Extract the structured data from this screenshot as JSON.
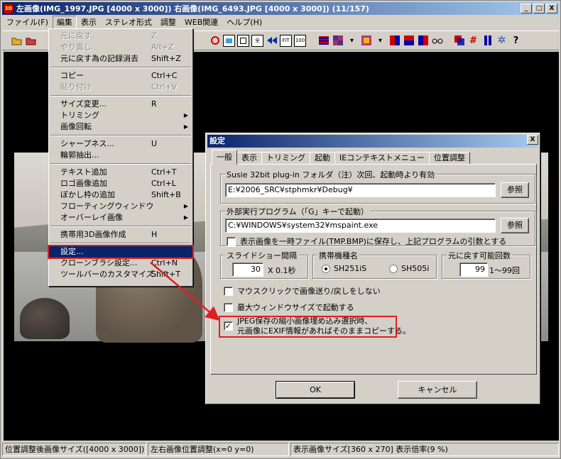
{
  "window": {
    "title": "左画像(IMG_1997.JPG [4000 x 3000]) 右画像(IMG_6493.JPG [4000 x 3000])  (11/157)",
    "app_icon": "3D",
    "buttons": {
      "minimize": "_",
      "maximize": "□",
      "close": "X"
    }
  },
  "menubar": [
    {
      "label": "ファイル(F)"
    },
    {
      "label": "編集"
    },
    {
      "label": "表示"
    },
    {
      "label": "ステレオ形式"
    },
    {
      "label": "調整"
    },
    {
      "label": "WEB関連"
    },
    {
      "label": "ヘルプ(H)"
    }
  ],
  "toolbar": {
    "fit_label": "FIT",
    "zoom_label": "100",
    "help_label": "?"
  },
  "edit_menu": {
    "items": [
      {
        "label": "元に戻す",
        "key": "Z",
        "disabled": true
      },
      {
        "label": "やり直し",
        "key": "Alt+Z",
        "disabled": true
      },
      {
        "label": "元に戻す為の記録消去",
        "key": "Shift+Z"
      },
      {
        "label": "コピー",
        "key": "Ctrl+C"
      },
      {
        "label": "貼り付け",
        "key": "Ctrl+V",
        "disabled": true
      },
      {
        "label": "サイズ変更...",
        "key": "R"
      },
      {
        "label": "トリミング"
      },
      {
        "label": "画像回転"
      },
      {
        "label": "シャープネス...",
        "key": "U"
      },
      {
        "label": "輪郭抽出..."
      },
      {
        "label": "テキスト追加",
        "key": "Ctrl+T"
      },
      {
        "label": "ロゴ画像追加",
        "key": "Ctrl+L"
      },
      {
        "label": "ぼかし枠の追加",
        "key": "Shift+B"
      },
      {
        "label": "フローティングウィンドウ"
      },
      {
        "label": "オーバーレイ画像"
      },
      {
        "label": "携帯用3D画像作成",
        "key": "H"
      },
      {
        "label": "設定..."
      },
      {
        "label": "クローンブラシ設定...",
        "key": "Ctrl+N"
      },
      {
        "label": "ツールバーのカスタマイズ...",
        "key": "Shift+T"
      }
    ]
  },
  "status": {
    "pane1": "位置調整後画像サイズ([4000 x 3000])",
    "pane2": "左右画像位置調整(x=0 y=0)",
    "pane3": "表示画像サイズ[360 x 270]  表示倍率(9 %)"
  },
  "dialog": {
    "title": "設定",
    "close": "X",
    "tabs": [
      "一般",
      "表示",
      "トリミング",
      "起動",
      "IEコンテキストメニュー",
      "位置調整"
    ],
    "susie": {
      "legend": "Susie 32bit plug-in フォルダ（注）次回、起動時より有効",
      "value": "E:¥2006_SRC¥stphmkr¥Debug¥",
      "browse": "参照"
    },
    "external": {
      "legend": "外部実行プログラム（「G」キーで起動）",
      "value": "C:¥WINDOWS¥system32¥mspaint.exe",
      "browse": "参照",
      "tmp_option": "表示画像を一時ファイル(TMP.BMP)に保存し、上記プログラムの引数とする"
    },
    "slideshow": {
      "legend": "スライドショー間隔",
      "value": "30",
      "unit": "X 0.1秒"
    },
    "phone": {
      "legend": "携帯機種名",
      "option1": "SH251iS",
      "option2": "SH505i",
      "selected": "SH251iS"
    },
    "undo": {
      "legend": "元に戻す可能回数",
      "value": "99",
      "range": "1～99回"
    },
    "options": {
      "mouse_click": "マウスクリックで画像送り/戻しをしない",
      "maximize": "最大ウィンドウサイズで起動する",
      "jpeg_line1": "JPEG保存の縮小画像埋め込み選択時、",
      "jpeg_line2": "元画像にEXIF情報があればそのままコピーする。",
      "jpeg_checked": "✓"
    },
    "ok": "OK",
    "cancel": "キャンセル"
  },
  "colors": {
    "titlebar": "#0a246a",
    "annotation": "#e02020"
  }
}
